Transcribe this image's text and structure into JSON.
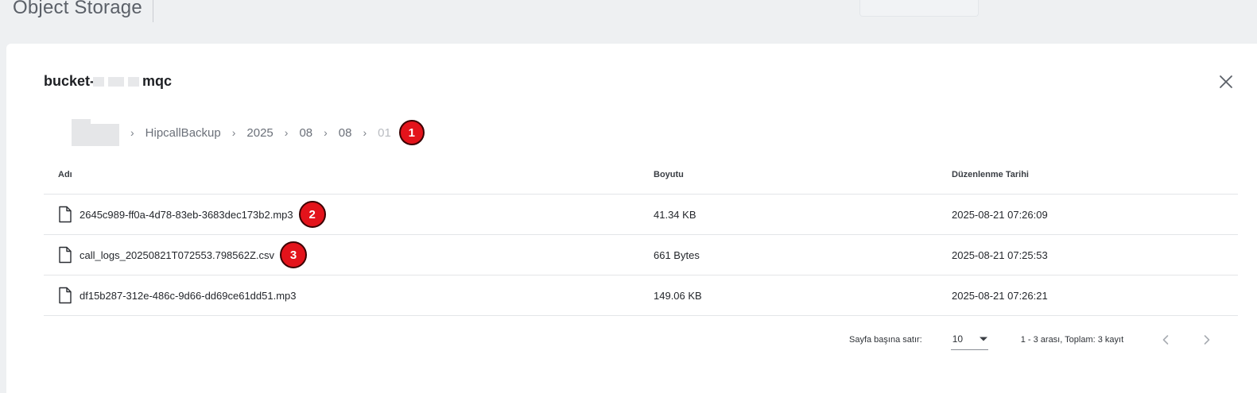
{
  "header": {
    "title": "Object Storage"
  },
  "dialog": {
    "bucket_prefix": "bucket-",
    "bucket_suffix": "mqc",
    "breadcrumb": [
      {
        "label": "HipcallBackup"
      },
      {
        "label": "2025"
      },
      {
        "label": "08"
      },
      {
        "label": "08"
      },
      {
        "label": "01"
      }
    ],
    "markers": [
      "1",
      "2",
      "3"
    ],
    "table": {
      "columns": [
        "Adı",
        "Boyutu",
        "Düzenlenme Tarihi"
      ],
      "rows": [
        {
          "name": "2645c989-ff0a-4d78-83eb-3683dec173b2.mp3",
          "size": "41.34 KB",
          "modified": "2025-08-21 07:26:09"
        },
        {
          "name": "call_logs_20250821T072553.798562Z.csv",
          "size": "661 Bytes",
          "modified": "2025-08-21 07:25:53"
        },
        {
          "name": "df15b287-312e-486c-9d66-dd69ce61dd51.mp3",
          "size": "149.06 KB",
          "modified": "2025-08-21 07:26:21"
        }
      ]
    },
    "pagination": {
      "rows_per_page_label": "Sayfa başına satır:",
      "rows_per_page": "10",
      "range_text": "1 - 3 arası, Toplam: 3 kayıt"
    }
  },
  "colors": {
    "marker": "#e3131b",
    "background": "#eef0f2",
    "panel": "#ffffff"
  },
  "icons": {
    "close": "close-icon",
    "file": "file-icon",
    "chevron": "chevron-right-icon",
    "dropdown": "caret-down-icon"
  }
}
